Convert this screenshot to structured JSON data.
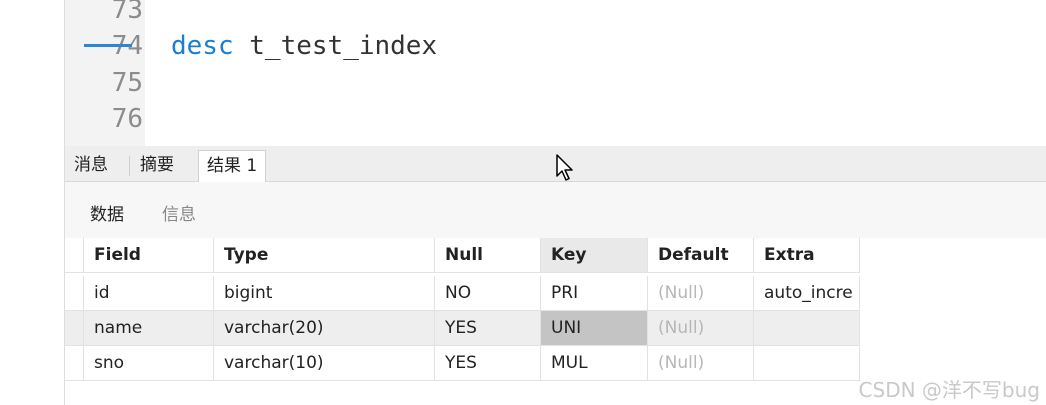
{
  "editor": {
    "lines": [
      {
        "number": "73",
        "code_keyword": "",
        "code_rest": ""
      },
      {
        "number": "74",
        "code_keyword": "desc",
        "code_rest": " t_test_index"
      },
      {
        "number": "75",
        "code_keyword": "",
        "code_rest": ""
      },
      {
        "number": "76",
        "code_keyword": "",
        "code_rest": ""
      }
    ]
  },
  "result_tabs": {
    "items": [
      "消息",
      "摘要",
      "结果 1"
    ],
    "active": "结果 1"
  },
  "sub_tabs": {
    "items": [
      "数据",
      "信息"
    ],
    "active": "数据"
  },
  "grid": {
    "columns": [
      "Field",
      "Type",
      "Null",
      "Key",
      "Default",
      "Extra"
    ],
    "sorted_column": "Key",
    "rows": [
      [
        "id",
        "bigint",
        "NO",
        "PRI",
        "(Null)",
        "auto_incre"
      ],
      [
        "name",
        "varchar(20)",
        "YES",
        "UNI",
        "(Null)",
        ""
      ],
      [
        "sno",
        "varchar(10)",
        "YES",
        "MUL",
        "(Null)",
        ""
      ]
    ],
    "selected_cell": {
      "row": 1,
      "column": "Key"
    }
  },
  "watermark": "CSDN @洋不写bug",
  "colors": {
    "keyword": "#1a7fd4",
    "tab_underline": "#2a86d8",
    "null_text": "#b7b7b7",
    "selected_cell": "#c4c4c4"
  },
  "icons": {
    "cursor": "mouse-pointer-icon"
  }
}
